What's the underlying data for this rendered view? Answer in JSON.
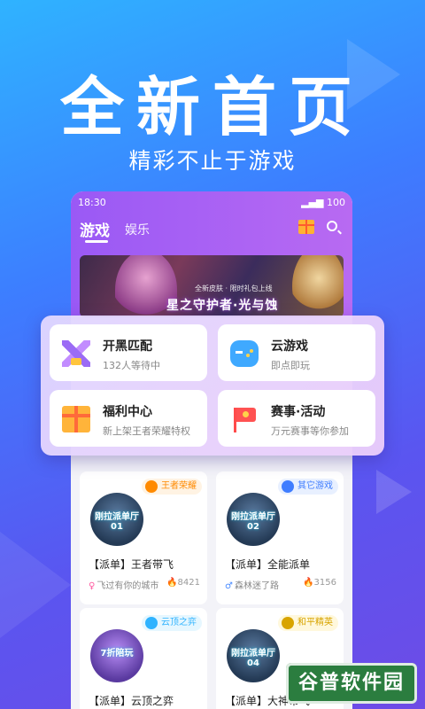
{
  "hero": {
    "title": "全新首页",
    "subtitle": "精彩不止于游戏"
  },
  "status_bar": {
    "time": "18:30",
    "battery": "100"
  },
  "top_tabs": [
    {
      "label": "游戏",
      "active": true
    },
    {
      "label": "娱乐",
      "active": false
    }
  ],
  "banner": {
    "small_text": "全新皮肤 · 限时礼包上线",
    "caption": "星之守护者·光与蚀"
  },
  "quick_entries": [
    {
      "title": "开黑匹配",
      "subtitle": "132人等待中",
      "icon": "crossed-swords-icon"
    },
    {
      "title": "云游戏",
      "subtitle": "即点即玩",
      "icon": "gamepad-icon"
    },
    {
      "title": "福利中心",
      "subtitle": "新上架王者荣耀特权",
      "icon": "gift-icon"
    },
    {
      "title": "赛事·活动",
      "subtitle": "万元赛事等你参加",
      "icon": "flag-icon"
    }
  ],
  "rooms": [
    {
      "tag": "王者荣耀",
      "tag_color": "#ff8a00",
      "cover_text": "刚拉派单厅 01",
      "title": "【派单】王者带飞",
      "user": "飞过有你的城市",
      "gender": "female",
      "hot": "8421"
    },
    {
      "tag": "其它游戏",
      "tag_color": "#3f7dff",
      "cover_text": "刚拉派单厅 02",
      "title": "【派单】全能派单",
      "user": "森林迷了路",
      "gender": "male",
      "hot": "3156"
    },
    {
      "tag": "云顶之弈",
      "tag_color": "#2fb3ff",
      "cover_text": "7折陪玩",
      "title": "【派单】云顶之弈",
      "user": "",
      "gender": "",
      "hot": ""
    },
    {
      "tag": "和平精英",
      "tag_color": "#d8a400",
      "cover_text": "刚拉派单厅 04",
      "title": "【派单】大神带飞",
      "user": "",
      "gender": "",
      "hot": ""
    }
  ],
  "watermark": "谷普软件园",
  "colors": {
    "phone_header": "#9a59f5",
    "accent": "#3d7dff"
  }
}
